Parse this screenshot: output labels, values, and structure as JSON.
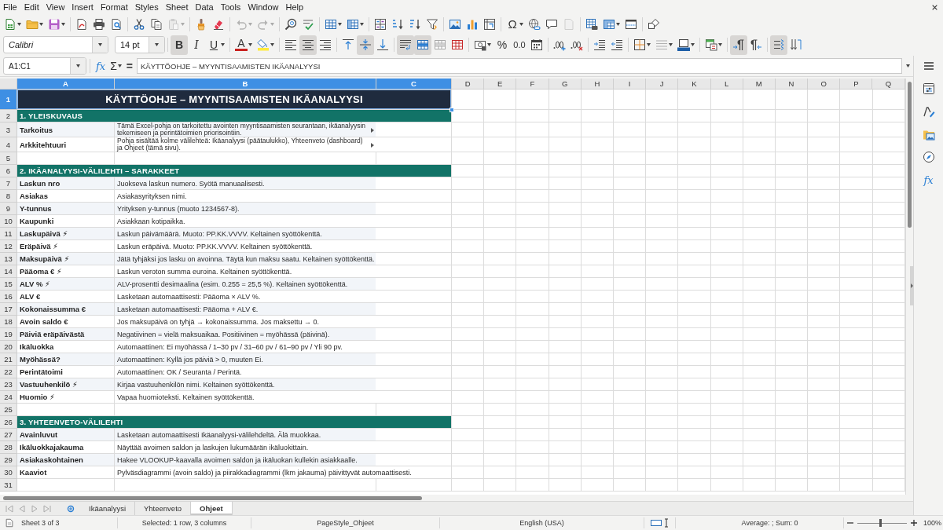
{
  "menu_bar": [
    "File",
    "Edit",
    "View",
    "Insert",
    "Format",
    "Styles",
    "Sheet",
    "Data",
    "Tools",
    "Window",
    "Help"
  ],
  "standard_toolbar": [
    [
      {
        "kind": "new",
        "disabled": false
      },
      {
        "kind": "open",
        "disabled": false
      },
      {
        "kind": "save",
        "disabled": false
      }
    ],
    [
      {
        "kind": "pdf",
        "disabled": false
      },
      {
        "kind": "print",
        "disabled": false
      },
      {
        "kind": "preview",
        "disabled": false
      }
    ],
    [
      {
        "kind": "cut",
        "disabled": false
      },
      {
        "kind": "copy",
        "disabled": false
      },
      {
        "kind": "paste",
        "disabled": true
      }
    ],
    [
      {
        "kind": "clone",
        "disabled": false
      },
      {
        "kind": "clear",
        "disabled": false
      }
    ],
    [
      {
        "kind": "undo",
        "disabled": true
      },
      {
        "kind": "redo",
        "disabled": true
      }
    ],
    [
      {
        "kind": "find",
        "disabled": false
      },
      {
        "kind": "spelling",
        "disabled": false
      }
    ],
    [
      {
        "kind": "row",
        "disabled": false
      },
      {
        "kind": "column",
        "disabled": false
      }
    ],
    [
      {
        "kind": "sort",
        "disabled": false
      },
      {
        "kind": "sortasc",
        "disabled": false
      },
      {
        "kind": "sortdesc",
        "disabled": false
      },
      {
        "kind": "filter",
        "disabled": false
      }
    ],
    [
      {
        "kind": "image",
        "disabled": false
      },
      {
        "kind": "chart",
        "disabled": false
      },
      {
        "kind": "pivot",
        "disabled": false
      }
    ],
    [
      {
        "kind": "special",
        "label": "Ω",
        "disabled": false
      },
      {
        "kind": "link",
        "disabled": false
      },
      {
        "kind": "comment",
        "disabled": false
      },
      {
        "kind": "headerfooter",
        "disabled": true
      }
    ],
    [
      {
        "kind": "printarea",
        "disabled": false
      },
      {
        "kind": "freeze",
        "disabled": false
      },
      {
        "kind": "split",
        "disabled": false
      }
    ],
    [
      {
        "kind": "draw",
        "disabled": false
      }
    ]
  ],
  "format_toolbar": {
    "font_name": "Calibri",
    "font_size": "14 pt",
    "groups": [
      [
        {
          "kind": "bold",
          "label": "B",
          "on": true
        },
        {
          "kind": "italic",
          "label": "I",
          "on": false
        },
        {
          "kind": "underline",
          "label": "U",
          "on": false
        }
      ],
      [
        {
          "kind": "fontcolor",
          "label": "A",
          "on": false
        },
        {
          "kind": "highlight",
          "on": false
        }
      ],
      [
        {
          "kind": "alignleft",
          "on": false
        },
        {
          "kind": "aligncenter",
          "on": true
        },
        {
          "kind": "alignright",
          "on": false
        }
      ],
      [
        {
          "kind": "aligntop",
          "on": false
        },
        {
          "kind": "alignmiddle",
          "on": true
        },
        {
          "kind": "alignbottom",
          "on": false
        }
      ],
      [
        {
          "kind": "wrap",
          "on": true
        },
        {
          "kind": "mergecenter",
          "on": true
        },
        {
          "kind": "merge",
          "on": false
        },
        {
          "kind": "unmerge",
          "on": false
        }
      ],
      [
        {
          "kind": "currency",
          "on": false
        },
        {
          "kind": "percent",
          "label": "%",
          "on": false
        },
        {
          "kind": "number",
          "label": "0.0",
          "on": false
        },
        {
          "kind": "date",
          "on": false
        }
      ],
      [
        {
          "kind": "adddecimal",
          "on": false
        },
        {
          "kind": "deldecimal",
          "on": false
        }
      ],
      [
        {
          "kind": "indent",
          "on": false
        },
        {
          "kind": "outdent",
          "on": false
        }
      ],
      [
        {
          "kind": "borders",
          "on": false
        },
        {
          "kind": "borderstyle",
          "on": false
        },
        {
          "kind": "bordercolor",
          "on": false
        }
      ],
      [
        {
          "kind": "conditional",
          "on": false
        }
      ],
      [
        {
          "kind": "ltr",
          "on": true
        },
        {
          "kind": "rtl",
          "on": false
        }
      ],
      [
        {
          "kind": "textdir",
          "on": true
        },
        {
          "kind": "stacked",
          "on": false
        }
      ]
    ]
  },
  "formula_bar": {
    "name_box": "A1:C1",
    "function_wizard": "fx",
    "sum": "Σ",
    "equals": "=",
    "content": "KÄYTTÖOHJE – MYYNTISAAMISTEN IKÄANALYYSI"
  },
  "sheet": {
    "columns": [
      {
        "label": "A",
        "selected": true
      },
      {
        "label": "B",
        "selected": true
      },
      {
        "label": "C",
        "selected": true
      },
      {
        "label": "D",
        "selected": false
      },
      {
        "label": "E",
        "selected": false
      },
      {
        "label": "F",
        "selected": false
      },
      {
        "label": "G",
        "selected": false
      },
      {
        "label": "H",
        "selected": false
      },
      {
        "label": "I",
        "selected": false
      },
      {
        "label": "J",
        "selected": false
      },
      {
        "label": "K",
        "selected": false
      },
      {
        "label": "L",
        "selected": false
      },
      {
        "label": "M",
        "selected": false
      },
      {
        "label": "N",
        "selected": false
      },
      {
        "label": "O",
        "selected": false
      },
      {
        "label": "P",
        "selected": false
      },
      {
        "label": "Q",
        "selected": false
      }
    ],
    "rows": [
      {
        "number": "1",
        "selected": true,
        "kind": "title",
        "text": "KÄYTTÖOHJE – MYYNTISAAMISTEN IKÄANALYYSI"
      },
      {
        "number": "2",
        "selected": false,
        "kind": "section",
        "text": "1. YLEISKUVAUS"
      },
      {
        "number": "3",
        "selected": false,
        "kind": "item",
        "label": "Tarkoitus",
        "text": "Tämä Excel-pohja on tarkoitettu avointen myyntisaamisten seurantaan, ikäanalyysin tekemiseen ja perintätoimien priorisointiin.",
        "shaded": true,
        "clipped": true
      },
      {
        "number": "4",
        "selected": false,
        "kind": "item",
        "label": "Arkkitehtuuri",
        "text": "Pohja sisältää kolme välilehteä: Ikäanalyysi (päätaulukko), Yhteenveto (dashboard) ja Ohjeet (tämä sivu).",
        "shaded": false,
        "clipped": true
      },
      {
        "number": "5",
        "selected": false,
        "kind": "blank"
      },
      {
        "number": "6",
        "selected": false,
        "kind": "section",
        "text": "2. IKÄANALYYSI-VÄLILEHTI – SARAKKEET"
      },
      {
        "number": "7",
        "selected": false,
        "kind": "item",
        "label": "Laskun nro",
        "text": "Juokseva laskun numero. Syötä manuaalisesti.",
        "shaded": true,
        "clipped": false
      },
      {
        "number": "8",
        "selected": false,
        "kind": "item",
        "label": "Asiakas",
        "text": "Asiakasyrityksen nimi.",
        "shaded": false,
        "clipped": false
      },
      {
        "number": "9",
        "selected": false,
        "kind": "item",
        "label": "Y-tunnus",
        "text": "Yrityksen y-tunnus (muoto 1234567-8).",
        "shaded": true,
        "clipped": false
      },
      {
        "number": "10",
        "selected": false,
        "kind": "item",
        "label": "Kaupunki",
        "text": "Asiakkaan kotipaikka.",
        "shaded": false,
        "clipped": false
      },
      {
        "number": "11",
        "selected": false,
        "kind": "item",
        "label": "Laskupäivä ⚡",
        "text": "Laskun päivämäärä. Muoto: PP.KK.VVVV. Keltainen syöttökenttä.",
        "shaded": true,
        "clipped": false
      },
      {
        "number": "12",
        "selected": false,
        "kind": "item",
        "label": "Eräpäivä ⚡",
        "text": "Laskun eräpäivä. Muoto: PP.KK.VVVV. Keltainen syöttökenttä.",
        "shaded": false,
        "clipped": false
      },
      {
        "number": "13",
        "selected": false,
        "kind": "item",
        "label": "Maksupäivä ⚡",
        "text": "Jätä tyhjäksi jos lasku on avoinna. Täytä kun maksu saatu. Keltainen syöttökenttä.",
        "shaded": true,
        "clipped": false
      },
      {
        "number": "14",
        "selected": false,
        "kind": "item",
        "label": "Pääoma € ⚡",
        "text": "Laskun veroton summa euroina. Keltainen syöttökenttä.",
        "shaded": false,
        "clipped": false
      },
      {
        "number": "15",
        "selected": false,
        "kind": "item",
        "label": "ALV % ⚡",
        "text": "ALV-prosentti desimaalina (esim. 0.255 = 25,5 %). Keltainen syöttökenttä.",
        "shaded": true,
        "clipped": false
      },
      {
        "number": "16",
        "selected": false,
        "kind": "item",
        "label": "ALV €",
        "text": "Lasketaan automaattisesti: Pääoma × ALV %.",
        "shaded": false,
        "clipped": false
      },
      {
        "number": "17",
        "selected": false,
        "kind": "item",
        "label": "Kokonaissumma €",
        "text": "Lasketaan automaattisesti: Pääoma + ALV €.",
        "shaded": true,
        "clipped": false
      },
      {
        "number": "18",
        "selected": false,
        "kind": "item",
        "label": "Avoin saldo €",
        "text": "Jos maksupäivä on tyhjä → kokonaissumma. Jos maksettu → 0.",
        "shaded": false,
        "clipped": false
      },
      {
        "number": "19",
        "selected": false,
        "kind": "item",
        "label": "Päiviä eräpäivästä",
        "text": "Negatiivinen = vielä maksuaikaa. Positiivinen = myöhässä (päivinä).",
        "shaded": true,
        "clipped": false
      },
      {
        "number": "20",
        "selected": false,
        "kind": "item",
        "label": "Ikäluokka",
        "text": "Automaattinen: Ei myöhässä / 1–30 pv / 31–60 pv / 61–90 pv / Yli 90 pv.",
        "shaded": false,
        "clipped": false
      },
      {
        "number": "21",
        "selected": false,
        "kind": "item",
        "label": "Myöhässä?",
        "text": "Automaattinen: Kyllä jos päiviä > 0, muuten Ei.",
        "shaded": true,
        "clipped": false
      },
      {
        "number": "22",
        "selected": false,
        "kind": "item",
        "label": "Perintätoimi",
        "text": "Automaattinen: OK / Seuranta / Perintä.",
        "shaded": false,
        "clipped": false
      },
      {
        "number": "23",
        "selected": false,
        "kind": "item",
        "label": "Vastuuhenkilö ⚡",
        "text": "Kirjaa vastuuhenkilön nimi. Keltainen syöttökenttä.",
        "shaded": true,
        "clipped": false
      },
      {
        "number": "24",
        "selected": false,
        "kind": "item",
        "label": "Huomio ⚡",
        "text": "Vapaa huomioteksti. Keltainen syöttökenttä.",
        "shaded": false,
        "clipped": false
      },
      {
        "number": "25",
        "selected": false,
        "kind": "blank"
      },
      {
        "number": "26",
        "selected": false,
        "kind": "section",
        "text": "3. YHTEENVETO-VÄLILEHTI"
      },
      {
        "number": "27",
        "selected": false,
        "kind": "item",
        "label": "Avainluvut",
        "text": "Lasketaan automaattisesti Ikäanalyysi-välilehdeltä. Älä muokkaa.",
        "shaded": true,
        "clipped": false
      },
      {
        "number": "28",
        "selected": false,
        "kind": "item",
        "label": "Ikäluokkajakauma",
        "text": "Näyttää avoimen saldon ja laskujen lukumäärän ikäluokittain.",
        "shaded": false,
        "clipped": false
      },
      {
        "number": "29",
        "selected": false,
        "kind": "item",
        "label": "Asiakaskohtainen",
        "text": "Hakee VLOOKUP-kaavalla avoimen saldon ja ikäluokan kullekin asiakkaalle.",
        "shaded": true,
        "clipped": false
      },
      {
        "number": "30",
        "selected": false,
        "kind": "item",
        "label": "Kaaviot",
        "text": "Pylväsdiagrammi (avoin saldo) ja piirakkadiagrammi (lkm jakauma) päivittyvät automaattisesti.",
        "shaded": false,
        "clipped": false
      },
      {
        "number": "31",
        "selected": false,
        "kind": "blank"
      }
    ]
  },
  "sheet_tabs": [
    {
      "label": "Ikäanalyysi",
      "selected": false
    },
    {
      "label": "Yhteenveto",
      "selected": false
    },
    {
      "label": "Ohjeet",
      "selected": true
    }
  ],
  "sidebar": {
    "functions_label": "fx"
  },
  "status_bar": {
    "sheet": "Sheet 3 of 3",
    "selection": "Selected: 1 row, 3 columns",
    "page_style": "PageStyle_Ohjeet",
    "language": "English (USA)",
    "summary": "Average: ; Sum: 0",
    "zoom": {
      "level": 0.46,
      "reading": "100%"
    }
  }
}
